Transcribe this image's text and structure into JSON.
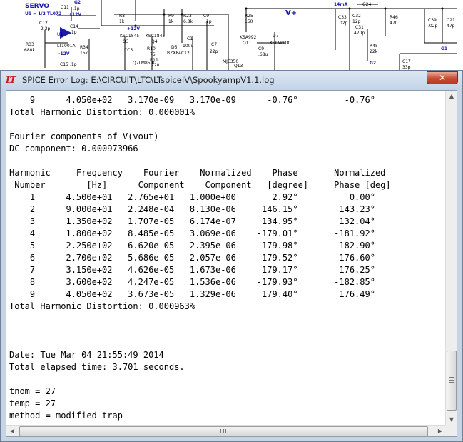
{
  "schematic": {
    "labels": {
      "servo": "SERVO",
      "u1": "U1 = 1/2 TL072",
      "g2": "G2",
      "c11": "C11",
      "c11_val": ".1p",
      "plus12v_a": "+12V",
      "c12": "C12",
      "c12_val": "2.2p",
      "u1_tag": "U1",
      "lt1001a": "LT1001A",
      "c14": "C14",
      "c14_val": ".1p",
      "minus12v": "-12V",
      "r33": "R33",
      "r33_val": "680k",
      "r34": "R34",
      "r34_val": "15k",
      "c15": "C15",
      "c15_val": ".1p",
      "r8": "R8",
      "r8_val": "1k",
      "ksc1845a": "KSC1845",
      "q3": "Q3",
      "plus12v_b": "+12V",
      "r9": "R9",
      "r9_val": "1k",
      "ksc1845b": "KSC1845",
      "q4": "Q4",
      "r23": "R23",
      "r23_val": "6.8k",
      "c9": "C9",
      "c9_val": ".1p",
      "cc": "CC5",
      "r10": "R10",
      "r10_val": "75",
      "q7": "Q7LM850C",
      "r11": "R11",
      "r11_val": "220",
      "d5": "D5",
      "bzx": "BZX84C12L",
      "c1": "C1",
      "c1_val": "100u",
      "c7": "C7",
      "c7_val": "22p",
      "r25": "R25",
      "r25_val": "150",
      "ksa992": "KSA992",
      "q11": "Q11",
      "d7": "D7",
      "kscw100": "KSCW100",
      "c9b": "C9",
      "c9b_val": ".68u",
      "mje350": "MJE350",
      "q13": "Q13",
      "vplus": "V+",
      "ma14": "14mA",
      "c33": "C33",
      "c33_val": ".02p",
      "c32": "C32",
      "c32_val": "12p",
      "c31": "C31",
      "c31_val": "470p",
      "q24": "Q24",
      "r46": "R46",
      "r46_val": "470",
      "r45": "R45",
      "r45_val": "22k",
      "g2b": "G2",
      "c39": "C39",
      "c39_val": ".02p",
      "c21": "C21",
      "c21_val": "47p",
      "g1": "G1",
      "c17": "C17",
      "c17_val": "33p"
    }
  },
  "window": {
    "title": "SPICE Error Log: E:\\CIRCUIT\\LTC\\LTspiceIV\\SpookyampV1.1.log",
    "close_glyph": "✕",
    "app_icon_glyph": "LT"
  },
  "log": {
    "lines": [
      "    9      4.050e+02   3.170e-09   3.170e-09      -0.76°         -0.76°",
      "Total Harmonic Distortion: 0.000001%",
      "",
      "Fourier components of V(vout)",
      "DC component:-0.000973966",
      "",
      "Harmonic     Frequency    Fourier    Normalized    Phase       Normalized",
      " Number        [Hz]      Component    Component   [degree]     Phase [deg]",
      "    1      4.500e+01   2.765e+01   1.000e+00       2.92°          0.00°",
      "    2      9.000e+01   2.248e-04   8.130e-06     146.15°        143.23°",
      "    3      1.350e+02   1.707e-05   6.174e-07     134.95°        132.04°",
      "    4      1.800e+02   8.485e-05   3.069e-06    -179.01°       -181.92°",
      "    5      2.250e+02   6.620e-05   2.395e-06    -179.98°       -182.90°",
      "    6      2.700e+02   5.686e-05   2.057e-06     179.52°        176.60°",
      "    7      3.150e+02   4.626e-05   1.673e-06     179.17°        176.25°",
      "    8      3.600e+02   4.247e-05   1.536e-06    -179.93°       -182.85°",
      "    9      4.050e+02   3.673e-05   1.329e-06     179.40°        176.49°",
      "Total Harmonic Distortion: 0.000963%",
      "",
      "",
      "",
      "Date: Tue Mar 04 21:55:49 2014",
      "Total elapsed time: 3.701 seconds.",
      "",
      "tnom = 27",
      "temp = 27",
      "method = modified trap"
    ]
  },
  "scrollbars": {
    "up_arrow": "▲",
    "down_arrow": "▼",
    "left_arrow": "◀",
    "right_arrow": "▶"
  }
}
